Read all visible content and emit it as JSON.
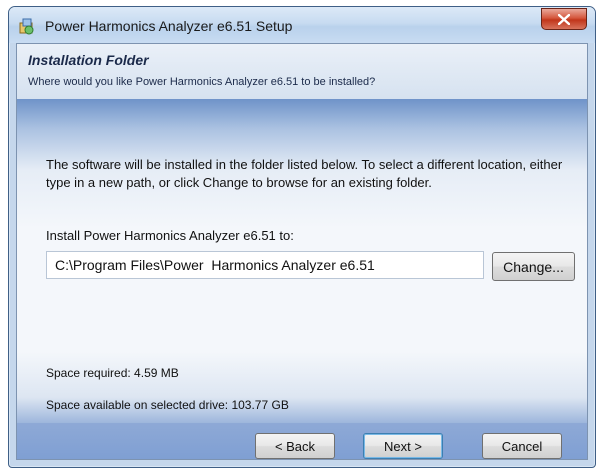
{
  "window": {
    "title": "Power  Harmonics Analyzer e6.51 Setup",
    "close_label": "x"
  },
  "header": {
    "title": "Installation Folder",
    "subtitle": "Where would you like Power  Harmonics Analyzer e6.51 to be installed?"
  },
  "body": {
    "description": "The software will be installed in the folder listed below. To select a different location, either type in a new path, or click Change to browse for an existing folder.",
    "install_label": "Install Power  Harmonics Analyzer e6.51 to:",
    "install_path": "C:\\Program Files\\Power  Harmonics Analyzer e6.51",
    "change_button": "Change...",
    "space_required": "Space required: 4.59 MB",
    "space_available": "Space available on selected drive: 103.77 GB"
  },
  "footer": {
    "back_button": "< Back",
    "next_button": "Next >",
    "cancel_button": "Cancel"
  },
  "icons": {
    "app": "installer-icon",
    "close": "close-icon"
  },
  "colors": {
    "close_button": "#c1361b",
    "body_gradient_top": "#6f93c9",
    "footer": "#8ea9d6"
  }
}
